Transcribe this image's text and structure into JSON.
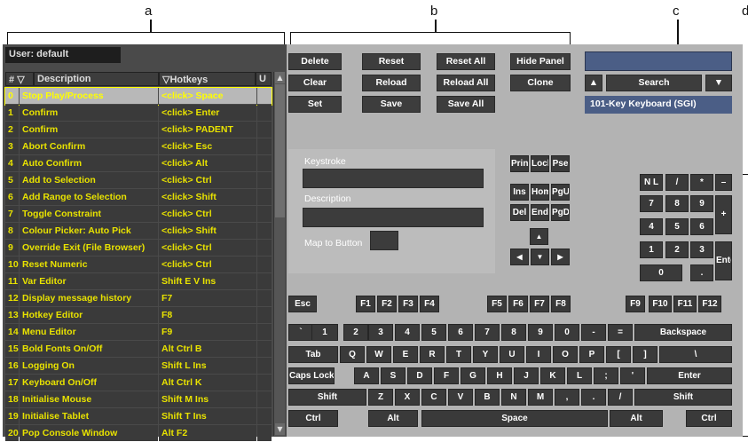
{
  "callouts": {
    "a": "a",
    "b": "b",
    "c": "c",
    "d": "d"
  },
  "user_label": "User: default",
  "columns": {
    "num": "#",
    "desc": "Description",
    "hotkeys": "Hotkeys",
    "u": "U",
    "filter_icon": "▽"
  },
  "rows": [
    {
      "n": "0",
      "d": "Stop Play/Process",
      "h": "<click> Space"
    },
    {
      "n": "1",
      "d": "Confirm",
      "h": "<click> Enter"
    },
    {
      "n": "2",
      "d": "Confirm",
      "h": "<click> PADENT"
    },
    {
      "n": "3",
      "d": "Abort Confirm",
      "h": "<click> Esc"
    },
    {
      "n": "4",
      "d": "Auto Confirm",
      "h": "<click> Alt"
    },
    {
      "n": "5",
      "d": "Add to Selection",
      "h": "<click> Ctrl"
    },
    {
      "n": "6",
      "d": "Add Range to Selection",
      "h": "<click> Shift"
    },
    {
      "n": "7",
      "d": "Toggle Constraint",
      "h": "<click> Ctrl"
    },
    {
      "n": "8",
      "d": "Colour Picker: Auto Pick",
      "h": "<click> Shift"
    },
    {
      "n": "9",
      "d": "Override Exit (File Browser)",
      "h": "<click> Ctrl"
    },
    {
      "n": "10",
      "d": "Reset Numeric",
      "h": "<click> Ctrl"
    },
    {
      "n": "11",
      "d": "Var Editor",
      "h": "Shift E V Ins"
    },
    {
      "n": "12",
      "d": "Display message history",
      "h": "F7"
    },
    {
      "n": "13",
      "d": "Hotkey Editor",
      "h": "F8"
    },
    {
      "n": "14",
      "d": "Menu Editor",
      "h": "F9"
    },
    {
      "n": "15",
      "d": "Bold Fonts On/Off",
      "h": "Alt Ctrl B"
    },
    {
      "n": "16",
      "d": "Logging On",
      "h": "Shift L Ins"
    },
    {
      "n": "17",
      "d": "Keyboard On/Off",
      "h": "Alt Ctrl K"
    },
    {
      "n": "18",
      "d": "Initialise Mouse",
      "h": "Shift M Ins"
    },
    {
      "n": "19",
      "d": "Initialise Tablet",
      "h": "Shift T Ins"
    },
    {
      "n": "20",
      "d": "Pop Console Window",
      "h": "Alt F2"
    }
  ],
  "buttons": {
    "delete": "Delete",
    "reset": "Reset",
    "reset_all": "Reset All",
    "hide_panel": "Hide Panel",
    "clear": "Clear",
    "reload": "Reload",
    "reload_all": "Reload All",
    "clone": "Clone",
    "set": "Set",
    "save": "Save",
    "save_all": "Save All"
  },
  "search": {
    "label": "Search",
    "value": ""
  },
  "keyboard_name": "101-Key Keyboard (SGI)",
  "panel": {
    "keystroke": "Keystroke",
    "description": "Description",
    "map_to_button": "Map to Button"
  },
  "keys": {
    "print": "Print",
    "lock": "Lock",
    "pse": "Pse",
    "ins": "Ins",
    "home": "Home",
    "pgup": "PgUp",
    "del": "Del",
    "end": "End",
    "pgdn": "PgDn",
    "esc": "Esc",
    "f1": "F1",
    "f2": "F2",
    "f3": "F3",
    "f4": "F4",
    "f5": "F5",
    "f6": "F6",
    "f7": "F7",
    "f8": "F8",
    "f9": "F9",
    "f10": "F10",
    "f11": "F11",
    "f12": "F12",
    "backtick": "`",
    "d1": "1",
    "d2": "2",
    "d3": "3",
    "d4": "4",
    "d5": "5",
    "d6": "6",
    "d7": "7",
    "d8": "8",
    "d9": "9",
    "d0": "0",
    "minus": "-",
    "equal": "=",
    "backspace": "Backspace",
    "tab": "Tab",
    "q": "Q",
    "w": "W",
    "e": "E",
    "r": "R",
    "t": "T",
    "y": "Y",
    "u": "U",
    "i": "I",
    "o": "O",
    "p": "P",
    "lbr": "[",
    "rbr": "]",
    "bslash": "\\",
    "capslock": "Caps Lock",
    "a": "A",
    "s": "S",
    "d": "D",
    "f": "F",
    "g": "G",
    "h": "H",
    "j": "J",
    "k": "K",
    "l": "L",
    "semi": ";",
    "quote": "'",
    "enter": "Enter",
    "shift": "Shift",
    "z": "Z",
    "x": "X",
    "c": "C",
    "v": "V",
    "b": "B",
    "n": "N",
    "m": "M",
    "comma": ",",
    "period": ".",
    "slash": "/",
    "ctrl": "Ctrl",
    "alt": "Alt",
    "space": "Space",
    "nl": "N L",
    "np_slash": "/",
    "np_star": "*",
    "np_minus": "–",
    "np7": "7",
    "np8": "8",
    "np9": "9",
    "np_plus": "+",
    "np4": "4",
    "np5": "5",
    "np6": "6",
    "np1": "1",
    "np2": "2",
    "np3": "3",
    "np_enter": "Enter",
    "np0": "0",
    "np_dot": "."
  }
}
